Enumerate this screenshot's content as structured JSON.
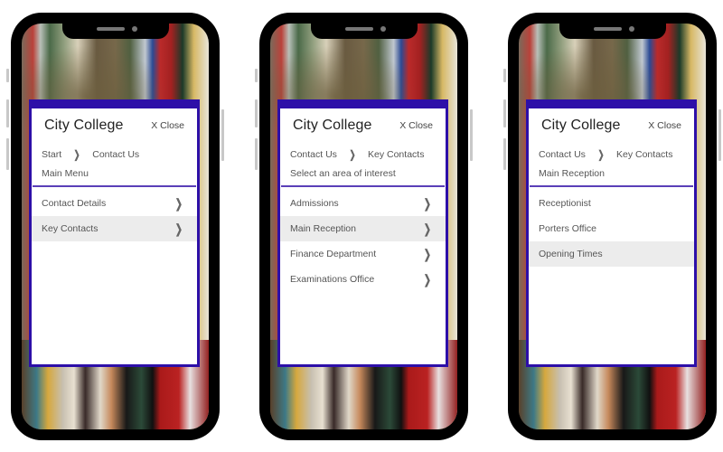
{
  "colors": {
    "accent": "#2d0fa8",
    "divider": "#5a3fb8",
    "active_row": "#ececec",
    "phone_frame": "#000000"
  },
  "phones": [
    {
      "app_title": "City College",
      "close_label": "X Close",
      "breadcrumb": [
        "Start",
        "Contact Us"
      ],
      "subtitle": "Main Menu",
      "menu": [
        {
          "label": "Contact Details",
          "icon": "chevron-right-icon",
          "has_chevron": true,
          "active": false
        },
        {
          "label": "Key Contacts",
          "icon": "chevron-right-icon",
          "has_chevron": true,
          "active": true
        }
      ]
    },
    {
      "app_title": "City College",
      "close_label": "X Close",
      "breadcrumb": [
        "Contact Us",
        "Key Contacts"
      ],
      "subtitle": "Select an area of interest",
      "menu": [
        {
          "label": "Admissions",
          "icon": "chevron-right-icon",
          "has_chevron": true,
          "active": false
        },
        {
          "label": "Main Reception",
          "icon": "chevron-right-icon",
          "has_chevron": true,
          "active": true
        },
        {
          "label": "Finance Department",
          "icon": "chevron-right-icon",
          "has_chevron": true,
          "active": false
        },
        {
          "label": "Examinations Office",
          "icon": "chevron-right-icon",
          "has_chevron": true,
          "active": false
        }
      ]
    },
    {
      "app_title": "City College",
      "close_label": "X Close",
      "breadcrumb": [
        "Contact Us",
        "Key Contacts"
      ],
      "subtitle": "Main Reception",
      "menu": [
        {
          "label": "Receptionist",
          "has_chevron": false,
          "active": false
        },
        {
          "label": "Porters Office",
          "has_chevron": false,
          "active": false
        },
        {
          "label": "Opening Times",
          "has_chevron": false,
          "active": true
        }
      ]
    }
  ],
  "glyphs": {
    "chevron": "❯",
    "breadcrumb_separator": "❯"
  }
}
